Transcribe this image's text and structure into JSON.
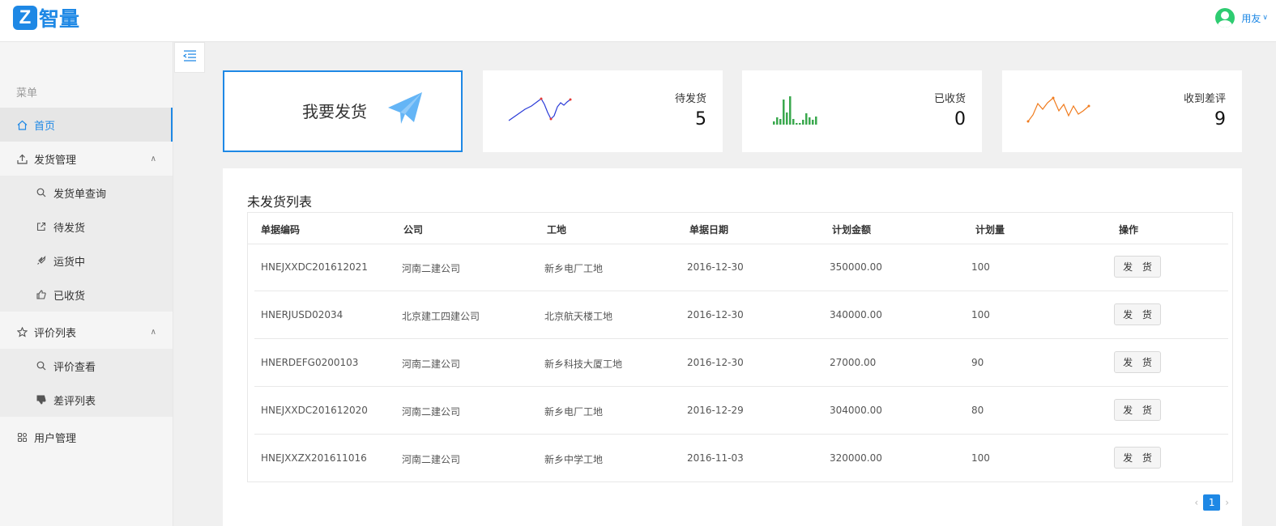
{
  "header": {
    "logo_letter": "Z",
    "logo_text": "智量",
    "user_name": "用友",
    "colors": {
      "brand": "#1e88e5",
      "avatar": "#2ecc71"
    }
  },
  "sidebar": {
    "menu_title": "菜单",
    "home": "首页",
    "shipping": {
      "label": "发货管理",
      "items": [
        "发货单查询",
        "待发货",
        "运货中",
        "已收货"
      ]
    },
    "reviews": {
      "label": "评价列表",
      "items": [
        "评价查看",
        "差评列表"
      ]
    },
    "users": "用户管理"
  },
  "cards": {
    "send": {
      "label": "我要发货",
      "icon": "paper-plane-icon"
    },
    "pending": {
      "label": "待发货",
      "value": "5",
      "sparkline": "line",
      "color": "#2a3bd8"
    },
    "received": {
      "label": "已收货",
      "value": "0",
      "sparkline": "bar",
      "color": "#3aa84e"
    },
    "negative": {
      "label": "收到差评",
      "value": "9",
      "sparkline": "line",
      "color": "#f07b1d"
    }
  },
  "table": {
    "title": "未发货列表",
    "columns": [
      "单据编码",
      "公司",
      "工地",
      "单据日期",
      "计划金额",
      "计划量",
      "操作"
    ],
    "rows": [
      [
        "HNEJXXDC201612021",
        "河南二建公司",
        "新乡电厂工地",
        "2016-12-30",
        "350000.00",
        "100",
        "发 货"
      ],
      [
        "HNERJUSD02034",
        "北京建工四建公司",
        "北京航天楼工地",
        "2016-12-30",
        "340000.00",
        "100",
        "发 货"
      ],
      [
        "HNERDEFG0200103",
        "河南二建公司",
        "新乡科技大厦工地",
        "2016-12-30",
        "27000.00",
        "90",
        "发 货"
      ],
      [
        "HNEJXXDC201612020",
        "河南二建公司",
        "新乡电厂工地",
        "2016-12-29",
        "304000.00",
        "80",
        "发 货"
      ],
      [
        "HNEJXXZX201611016",
        "河南二建公司",
        "新乡中学工地",
        "2016-11-03",
        "320000.00",
        "100",
        "发 货"
      ]
    ]
  },
  "pagination": {
    "current": "1",
    "prev": "‹",
    "next": "›"
  }
}
